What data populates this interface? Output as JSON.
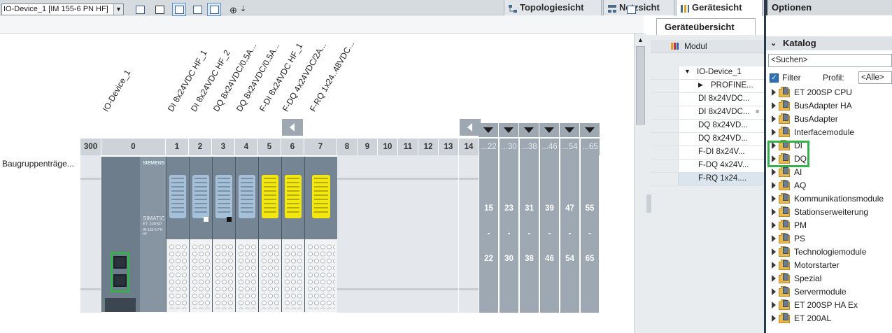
{
  "tabs": [
    {
      "label": "Topologiesicht",
      "icon": "topology-icon",
      "active": false
    },
    {
      "label": "Netzsicht",
      "icon": "network-icon",
      "active": false
    },
    {
      "label": "Gerätesicht",
      "icon": "device-icon",
      "active": true
    }
  ],
  "options_title": "Optionen",
  "toolbar": {
    "device_select": "IO-Device_1 [IM 155-6 PN HF]",
    "buttons": [
      "overview-icon",
      "name-icon",
      "view-icon",
      "grid-icon",
      "list-icon",
      "zoom-icon",
      "download-icon",
      "panel-toggle-icon"
    ]
  },
  "rack": {
    "row_label": "Baugruppenträge...",
    "module_labels": [
      "IO-Device_1",
      "DI 8x24VDC HF_1",
      "DI 8x24VDC HF_2",
      "DQ 8x24VDC/0.5A...",
      "DQ 8x24VDC/0.5A...",
      "F-DI 8x24VDC HF_1",
      "F-DQ 4x24VDC/2A...",
      "F-RQ 1x24..48VDC..."
    ],
    "slots": [
      "300",
      "0",
      "1",
      "2",
      "3",
      "4",
      "5",
      "6",
      "7",
      "8",
      "9",
      "10",
      "11",
      "12",
      "13",
      "14",
      "...22",
      "...30",
      "...38",
      "...46",
      "...54",
      "...65"
    ],
    "expansion_ranges": [
      {
        "from": "15",
        "to": "22"
      },
      {
        "from": "23",
        "to": "30"
      },
      {
        "from": "31",
        "to": "38"
      },
      {
        "from": "39",
        "to": "46"
      },
      {
        "from": "47",
        "to": "54"
      },
      {
        "from": "55",
        "to": "65"
      }
    ],
    "dash": "-",
    "brand": "SIEMENS",
    "head_text": [
      "SIMATIC",
      "ET 200SP",
      "IM 155-6 PN HF"
    ]
  },
  "overview": {
    "tab": "Geräteübersicht",
    "column": "Modul",
    "rows": [
      {
        "label": "IO-Device_1",
        "expander": "▼",
        "indent": 0
      },
      {
        "label": "PROFINE...",
        "expander": "▶",
        "indent": 1
      },
      {
        "label": "DI 8x24VDC...",
        "expander": "",
        "indent": 0
      },
      {
        "label": "DI 8x24VDC...",
        "expander": "",
        "indent": 0
      },
      {
        "label": "DQ 8x24VD...",
        "expander": "",
        "indent": 0
      },
      {
        "label": "DQ 8x24VD...",
        "expander": "",
        "indent": 0
      },
      {
        "label": "F-DI 8x24V...",
        "expander": "",
        "indent": 0
      },
      {
        "label": "F-DQ 4x24V...",
        "expander": "",
        "indent": 0
      },
      {
        "label": "F-RQ 1x24....",
        "expander": "",
        "indent": 0
      }
    ]
  },
  "catalog": {
    "title": "Katalog",
    "search_placeholder": "<Suchen>",
    "filter_label": "Filter",
    "filter_checked": true,
    "profile_label": "Profil:",
    "profile_value": "<Alle>",
    "items": [
      "ET 200SP CPU",
      "BusAdapter HA",
      "BusAdapter",
      "Interfacemodule",
      "DI",
      "DQ",
      "AI",
      "AQ",
      "Kommunikationsmodule",
      "Stationserweiterung",
      "PM",
      "PS",
      "Technologiemodule",
      "Motorstarter",
      "Spezial",
      "Servermodule",
      "ET 200SP HA Ex",
      "ET 200AL"
    ],
    "highlighted": [
      "DI",
      "DQ"
    ]
  },
  "colors": {
    "highlight": "#36b04a",
    "module_grey": "#a5c1da",
    "module_yellow": "#f2e70f"
  }
}
